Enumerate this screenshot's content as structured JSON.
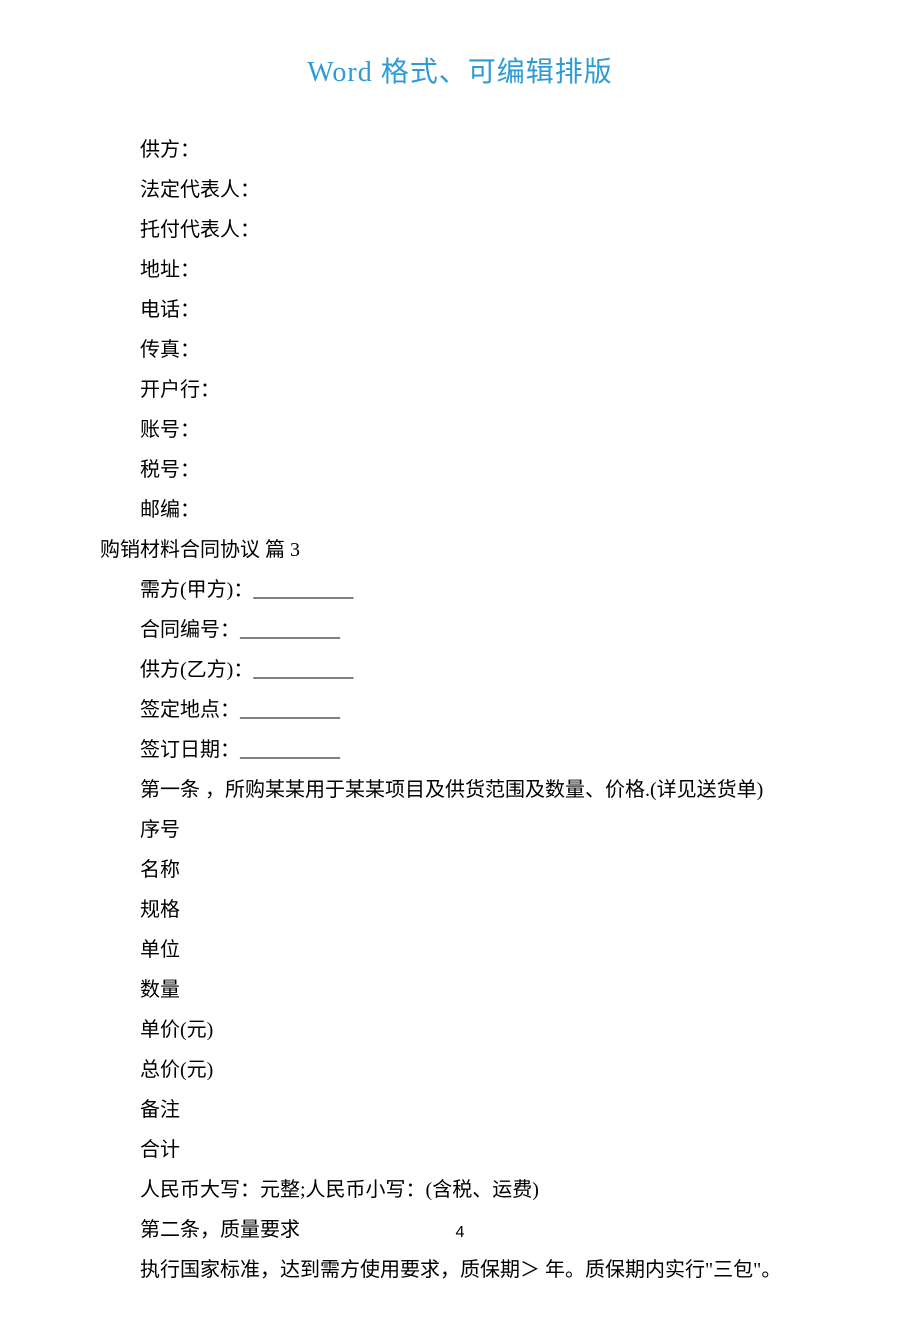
{
  "header": {
    "title": "Word 格式、可编辑排版"
  },
  "supplier_fields": {
    "l1": "供方：",
    "l2": "法定代表人：",
    "l3": "托付代表人：",
    "l4": "地址：",
    "l5": "电话：",
    "l6": "传真：",
    "l7": "开户行：",
    "l8": "账号：",
    "l9": "税号：",
    "l10": "邮编："
  },
  "section_title": "购销材料合同协议 篇 3",
  "contract_fields": {
    "c1": "需方(甲方)：__________",
    "c2": "合同编号：__________",
    "c3": "供方(乙方)：__________",
    "c4": "签定地点：__________",
    "c5": "签订日期：__________"
  },
  "article1": "第一条 ，所购某某用于某某项目及供货范围及数量、价格.(详见送货单)",
  "table_headers": {
    "t1": "序号",
    "t2": "名称",
    "t3": "规格",
    "t4": "单位",
    "t5": "数量",
    "t6": "单价(元)",
    "t7": "总价(元)",
    "t8": "备注",
    "t9": "合计"
  },
  "amount_line": "人民币大写：元整;人民币小写：(含税、运费)",
  "article2_title": "第二条，质量要求",
  "article2_body": "执行国家标准，达到需方使用要求，质保期＞ 年。质保期内实行\"三包\"。",
  "page_number": "4"
}
